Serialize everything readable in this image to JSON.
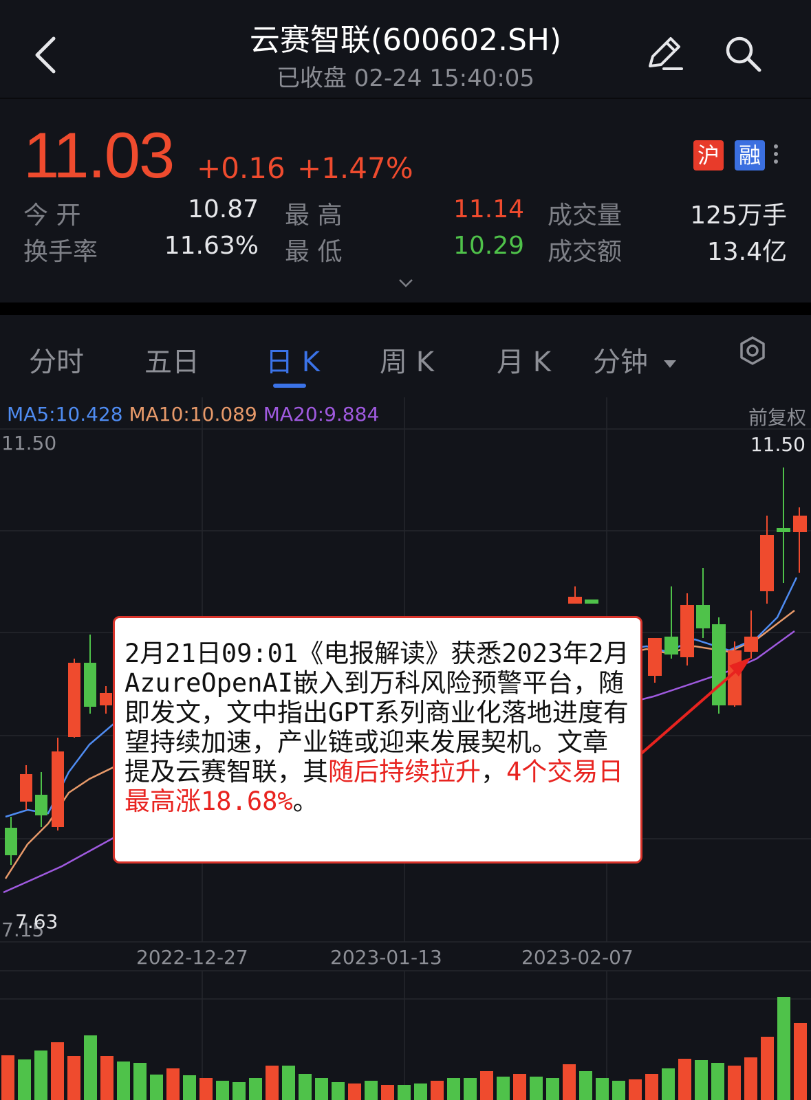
{
  "header": {
    "title": "云赛智联(600602.SH)",
    "status": "已收盘 02-24 15:40:05"
  },
  "quote": {
    "price": "11.03",
    "change": "+0.16",
    "change_pct": "+1.47%",
    "badges": [
      "沪",
      "融"
    ],
    "stats": [
      {
        "label": "今 开",
        "value": "10.87"
      },
      {
        "label": "最 高",
        "value": "11.14"
      },
      {
        "label": "成交量",
        "value": "125万手"
      },
      {
        "label": "换手率",
        "value": "11.63%"
      },
      {
        "label": "最 低",
        "value": "10.29"
      },
      {
        "label": "成交额",
        "value": "13.4亿"
      }
    ],
    "colors": {
      "up": "#ef4b2e",
      "down": "#4fc24a"
    }
  },
  "tabs": [
    {
      "label": "分时"
    },
    {
      "label": "五日"
    },
    {
      "label": "日 K",
      "active": true
    },
    {
      "label": "周 K"
    },
    {
      "label": "月 K"
    },
    {
      "label": "分钟"
    }
  ],
  "chart": {
    "ma5": "MA5:10.428",
    "ma10": "MA10:10.089",
    "ma20": "MA20:9.884",
    "adjust_label": "前复权",
    "y_top_left": "11.50",
    "y_top_right": "11.50",
    "y_bottom_left": "7.15",
    "y_low_marker": "7.63",
    "dates": [
      "2022-12-27",
      "2023-01-13",
      "2023-02-07"
    ]
  },
  "annotation": {
    "text1": "2月21日09:01《电报解读》获悉2023年2月AzureOpenAI嵌入到万科风险预警平台，随即发文，文中指出GPT系列商业化落地进度有望持续加速，产业链或迎来发展契机。文章提及云赛智联，其",
    "highlight1": "随后持续拉升",
    "text2": "，",
    "highlight2": "4个交易日最高涨18.68%",
    "text3": "。"
  },
  "chart_data": {
    "type": "candlestick",
    "ylim": [
      7.15,
      11.5
    ],
    "candles_visible": [
      {
        "open": 7.95,
        "close": 7.6,
        "high": 8.05,
        "low": 7.45
      },
      {
        "open": 8.3,
        "close": 8.6,
        "high": 8.7,
        "low": 8.15
      },
      {
        "open": 8.2,
        "close": 7.95,
        "high": 8.4,
        "low": 7.85
      },
      {
        "open": 8.1,
        "close": 8.9,
        "high": 9.1,
        "low": 8.0
      },
      {
        "open": 8.75,
        "close": 9.5,
        "high": 9.55,
        "low": 8.75
      },
      {
        "open": 9.5,
        "close": 9.05,
        "high": 9.8,
        "low": 8.95
      },
      {
        "open": 9.2,
        "close": 9.1,
        "high": 9.3,
        "low": 8.9
      },
      {
        "open": 10.4,
        "close": 10.35,
        "high": 10.5,
        "low": 10.2
      },
      {
        "open": 10.35,
        "close": 10.3,
        "high": 10.4,
        "low": 10.1
      },
      {
        "open": 9.4,
        "close": 9.7,
        "high": 9.8,
        "low": 9.3
      },
      {
        "open": 9.75,
        "close": 9.6,
        "high": 9.9,
        "low": 9.5
      },
      {
        "open": 9.85,
        "close": 10.3,
        "high": 10.5,
        "low": 9.8
      },
      {
        "open": 10.3,
        "close": 10.05,
        "high": 10.45,
        "low": 9.6
      },
      {
        "open": 10.0,
        "close": 9.2,
        "high": 10.1,
        "low": 9.05
      },
      {
        "open": 9.2,
        "close": 9.75,
        "high": 9.8,
        "low": 9.1
      },
      {
        "open": 9.8,
        "close": 10.1,
        "high": 10.2,
        "low": 9.75
      },
      {
        "open": 10.3,
        "close": 11.0,
        "high": 11.1,
        "low": 10.3
      },
      {
        "open": 11.0,
        "close": 10.95,
        "high": 11.45,
        "low": 10.4
      },
      {
        "open": 10.87,
        "close": 11.03,
        "high": 11.14,
        "low": 10.29
      }
    ]
  }
}
